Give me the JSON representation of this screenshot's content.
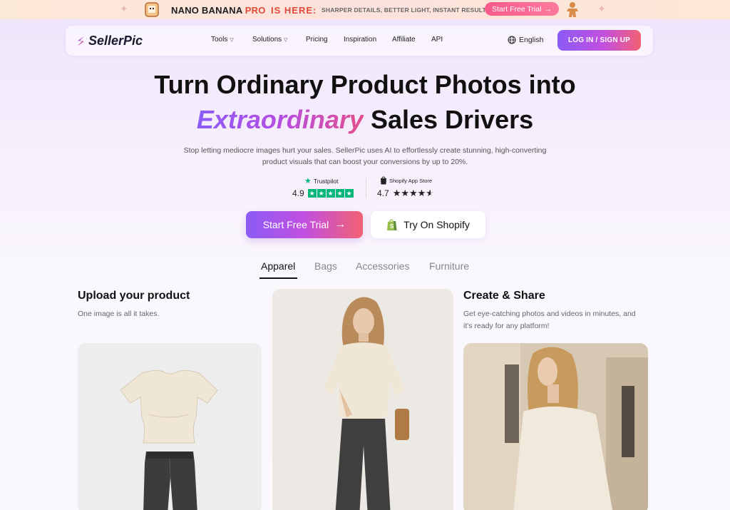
{
  "announcement": {
    "brand_main": "NANO BANANA ",
    "brand_pro": "PRO",
    "here": "IS HERE:",
    "subtitle": "SHARPER DETAILS, BETTER LIGHT, INSTANT RESULT.",
    "cta": "Start Free Trial",
    "cta_icon": "arrow-right-icon"
  },
  "nav": {
    "logo": "SellerPic",
    "items": [
      {
        "label": "Tools",
        "has_dropdown": true
      },
      {
        "label": "Solutions",
        "has_dropdown": true
      },
      {
        "label": "Pricing",
        "has_dropdown": false
      },
      {
        "label": "Inspiration",
        "has_dropdown": false
      },
      {
        "label": "Affiliate",
        "has_dropdown": false
      },
      {
        "label": "API",
        "has_dropdown": false
      }
    ],
    "language": "English",
    "login": "LOG IN / SIGN UP"
  },
  "hero": {
    "title_line1": "Turn Ordinary Product Photos into",
    "title_highlight": "Extraordinary",
    "title_line2_rest": " Sales Drivers",
    "description_line1": "Stop letting mediocre images hurt your sales. SellerPic uses AI to effortlessly create stunning, high-converting",
    "description_line2": "product visuals that can boost your conversions by up to 20%."
  },
  "ratings": {
    "trustpilot": {
      "label": "Trustpilot",
      "score": "4.9",
      "stars": 5
    },
    "shopify": {
      "label": "Shopify App Store",
      "score": "4.7",
      "stars": 4.5
    }
  },
  "cta": {
    "primary": "Start Free Trial",
    "secondary": "Try On Shopify"
  },
  "tabs": [
    {
      "label": "Apparel",
      "active": true
    },
    {
      "label": "Bags",
      "active": false
    },
    {
      "label": "Accessories",
      "active": false
    },
    {
      "label": "Furniture",
      "active": false
    }
  ],
  "steps": {
    "upload": {
      "title": "Upload your product",
      "text": "One image is all it takes."
    },
    "create": {
      "title": "Create & Share",
      "text_line1": "Get eye-catching photos and videos in minutes, and",
      "text_line2": "it's ready for any platform!"
    }
  },
  "colors": {
    "accent_purple": "#8b5cf6",
    "accent_pink": "#f36173",
    "trustpilot_green": "#00b67a",
    "announce_red": "#e0483a"
  }
}
